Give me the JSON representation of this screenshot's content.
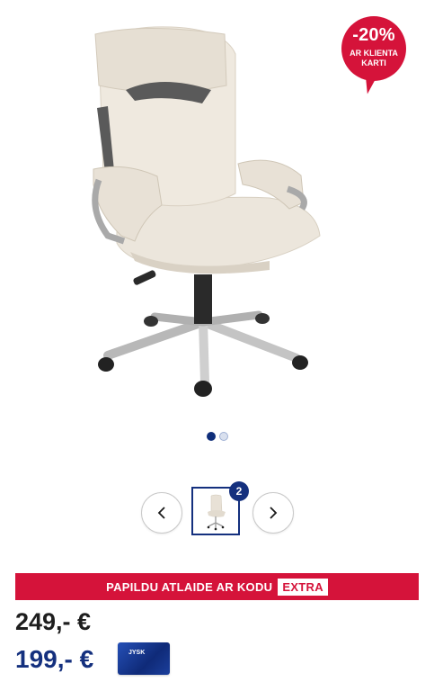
{
  "product": {
    "discount_badge": {
      "percent": "-20%",
      "subtitle_line1": "AR KLIENTA",
      "subtitle_line2": "KARTI"
    },
    "gallery": {
      "total_images": 1,
      "active_index": 0,
      "thumbnail_count": "2"
    },
    "promo": {
      "text": "PAPILDU ATLAIDE AR KODU",
      "code": "EXTRA"
    },
    "price_regular": "249,-  €",
    "price_member": "199,- €",
    "member_card_logo": "JYSK"
  },
  "colors": {
    "accent_red": "#d5133a",
    "brand_blue": "#14307e"
  },
  "icons": {
    "prev": "chevron-left-icon",
    "next": "chevron-right-icon"
  }
}
